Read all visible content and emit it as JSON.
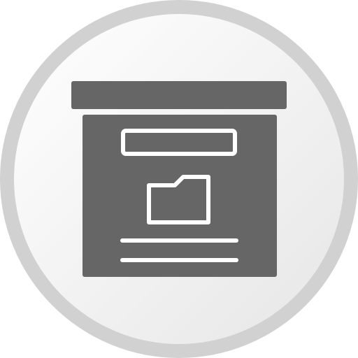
{
  "icon": {
    "name": "archive-box-icon",
    "colors": {
      "outer_ring": "#d1d1d1",
      "inner_circle_light": "#ffffff",
      "inner_circle_dark": "#e6e6e6",
      "box_fill": "#666666",
      "line_detail": "#ffffff"
    }
  }
}
